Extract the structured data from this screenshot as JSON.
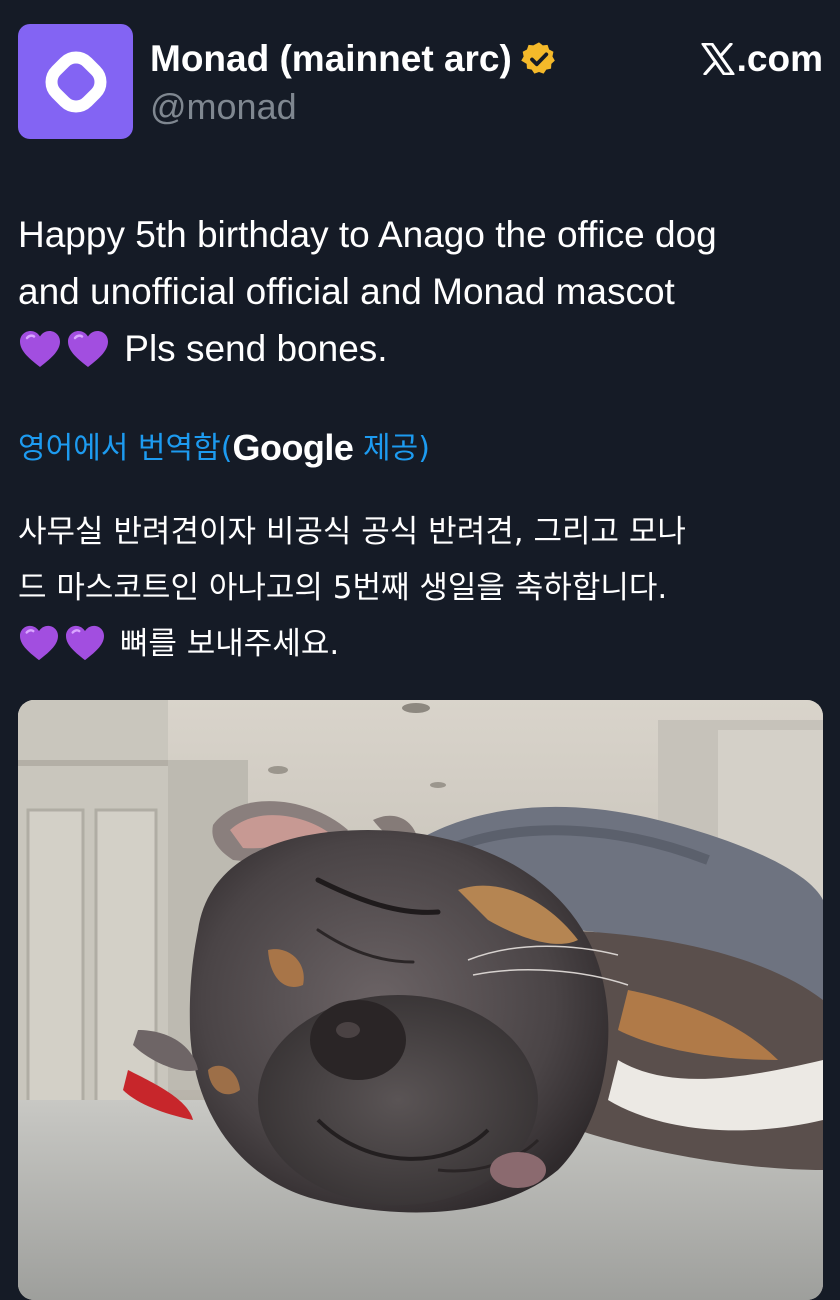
{
  "author": {
    "display_name": "Monad (mainnet arc)",
    "handle": "@monad",
    "verified_icon": "verified-badge-icon",
    "avatar_icon": "monad-logo-icon",
    "avatar_color": "#8364f3"
  },
  "site": {
    "label": ".com",
    "icon": "x-logo-icon"
  },
  "tweet": {
    "line1": "Happy 5th birthday to Anago the office dog",
    "line2": "and unofficial official and Monad mascot",
    "line3_text": "Pls send bones.",
    "emoji": "purple-heart"
  },
  "translation": {
    "prefix": "영어에서 번역함(",
    "provider": "Google",
    "suffix": " 제공)",
    "link_color": "#1d9bf0",
    "line1": "사무실 반려견이자 비공식 공식 반려견, 그리고 모나",
    "line2": "드 마스코트인 아나고의 5번째 생일을 축하합니다.",
    "line3_text": "뼈를 보내주세요."
  },
  "media": {
    "description_icon": "photo-sleeping-dog"
  },
  "colors": {
    "background": "#151b26",
    "handle_gray": "#7f8790",
    "verified_gold": "#f4b92a",
    "heart_purple": "#a24ee0"
  }
}
